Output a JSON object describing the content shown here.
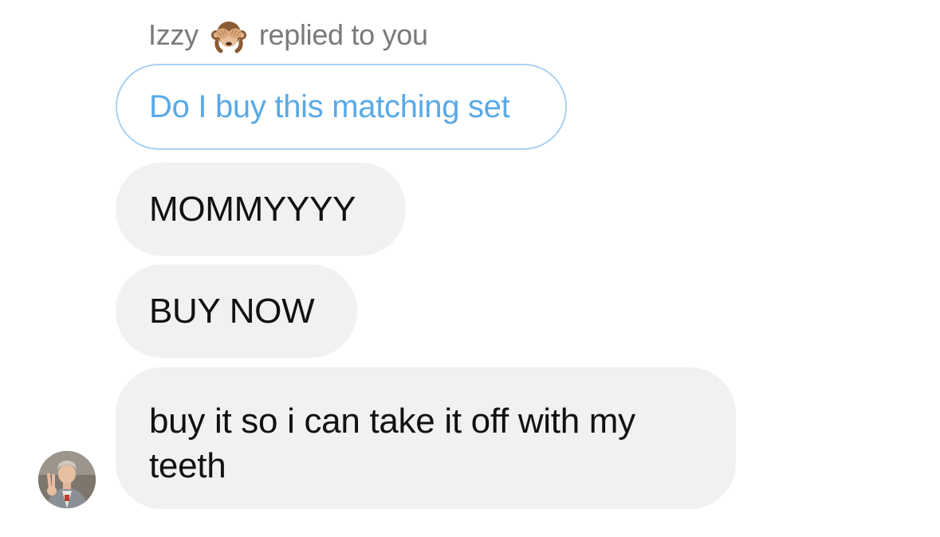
{
  "reply_header": {
    "name": "Izzy",
    "emoji_icon": "see-no-evil-monkey",
    "action_text": "replied to you"
  },
  "quoted_message": {
    "text": "Do I buy this matching set"
  },
  "messages": [
    {
      "text": "MOMMYYYY"
    },
    {
      "text": "BUY NOW"
    },
    {
      "text": "buy it so i can take it off with my teeth"
    }
  ],
  "colors": {
    "quoted_border": "#a9d1f2",
    "quoted_text": "#5aa9e6",
    "bubble_bg": "#f1f1f1",
    "header_text": "#7a7a7a"
  },
  "avatar": {
    "icon": "user-avatar-photo"
  }
}
